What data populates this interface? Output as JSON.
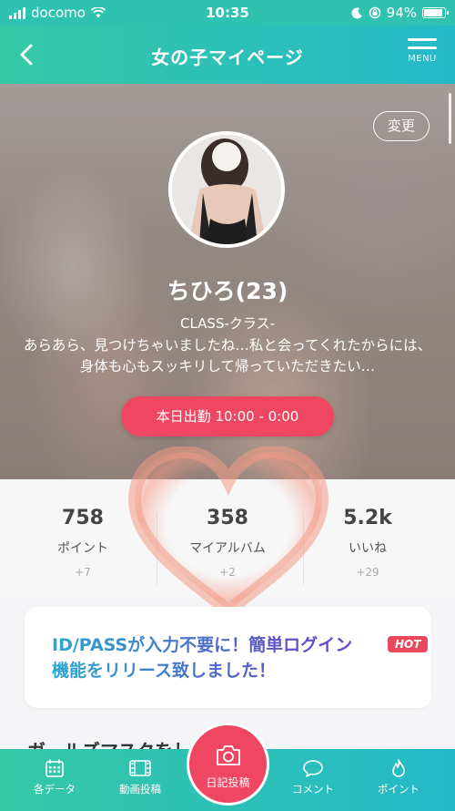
{
  "status_bar": {
    "carrier": "docomo",
    "time": "10:35",
    "battery": "94%",
    "battery_level": 0.94
  },
  "header": {
    "title": "女の子マイページ",
    "menu_label": "MENU",
    "back_icon": "chevron-left-icon",
    "menu_icon": "hamburger-icon"
  },
  "profile": {
    "change_label": "変更",
    "name": "ちひろ(23)",
    "shop": "CLASS-クラス-",
    "description": "あらあら、見つけちゃいましたね…私と会ってくれたからには、身体も心もスッキリして帰っていただきたい…",
    "shift": "本日出勤 10:00 - 0:00"
  },
  "stats": [
    {
      "value": "758",
      "label": "ポイント",
      "delta": "+7"
    },
    {
      "value": "358",
      "label": "マイアルバム",
      "delta": "+2"
    },
    {
      "value": "5.2k",
      "label": "いいね",
      "delta": "+29"
    }
  ],
  "banner": {
    "text": "ID/PASSが入力不要に！簡単ログイン機能をリリース致しました！",
    "badge": "HOT"
  },
  "section_title": "ガールズマスクをし",
  "tabbar": {
    "items": [
      {
        "label": "各データ",
        "icon": "calendar-icon"
      },
      {
        "label": "動画投稿",
        "icon": "film-icon"
      },
      {
        "label": "コメント",
        "icon": "speech-bubble-icon"
      },
      {
        "label": "ポイント",
        "icon": "flame-icon"
      }
    ],
    "center": {
      "label": "日記投稿",
      "icon": "camera-icon"
    }
  },
  "colors": {
    "primary_teal": "#2fc2b0",
    "accent_pink": "#ef4661",
    "hot_badge": "#e9495d"
  }
}
